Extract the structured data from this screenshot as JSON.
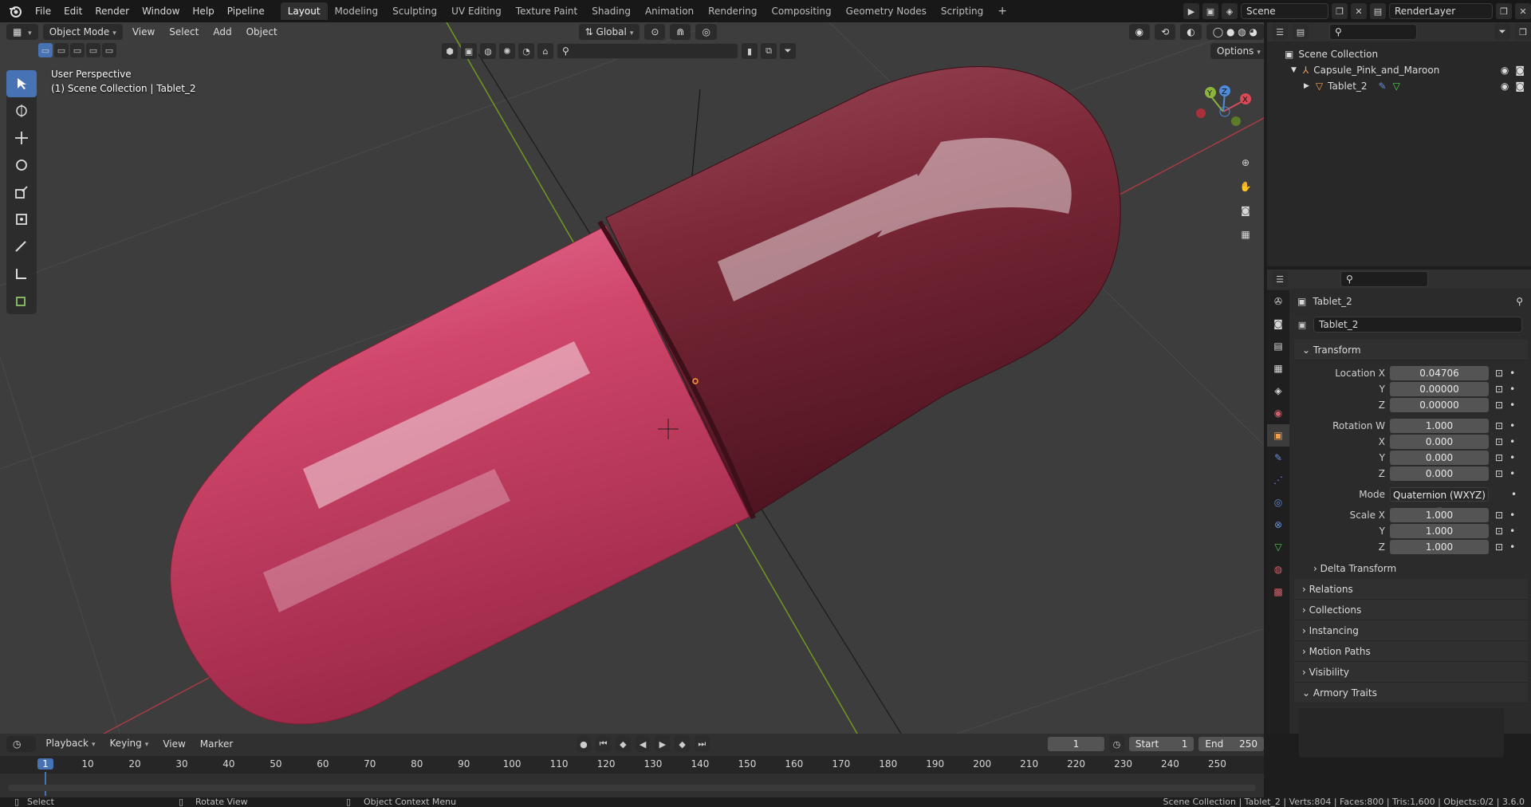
{
  "menus": [
    "File",
    "Edit",
    "Render",
    "Window",
    "Help",
    "Pipeline"
  ],
  "workspaces": [
    "Layout",
    "Modeling",
    "Sculpting",
    "UV Editing",
    "Texture Paint",
    "Shading",
    "Animation",
    "Rendering",
    "Compositing",
    "Geometry Nodes",
    "Scripting"
  ],
  "active_workspace": "Layout",
  "scene_name": "Scene",
  "render_layer": "RenderLayer",
  "viewport": {
    "mode": "Object Mode",
    "menu": [
      "View",
      "Select",
      "Add",
      "Object"
    ],
    "orientation": "Global",
    "options": "Options",
    "overlay_line1": "User Perspective",
    "overlay_line2": "(1) Scene Collection | Tablet_2",
    "gizmo": {
      "x": "X",
      "y": "Y",
      "z": "Z"
    }
  },
  "outliner": {
    "root": "Scene Collection",
    "items": [
      "Capsule_Pink_and_Maroon",
      "Tablet_2"
    ]
  },
  "properties": {
    "object_name": "Tablet_2",
    "data_name": "Tablet_2",
    "transform_label": "Transform",
    "location": {
      "label": "Location X",
      "x": "0.04706",
      "y": "0.00000",
      "z": "0.00000"
    },
    "rotation": {
      "label": "Rotation W",
      "w": "1.000",
      "x": "0.000",
      "y": "0.000",
      "z": "0.000"
    },
    "mode_label": "Mode",
    "mode_value": "Quaternion (WXYZ)",
    "scale": {
      "label": "Scale X",
      "x": "1.000",
      "y": "1.000",
      "z": "1.000"
    },
    "axis_y": "Y",
    "axis_z": "Z",
    "axis_x": "X",
    "sections": [
      "Delta Transform",
      "Relations",
      "Collections",
      "Instancing",
      "Motion Paths",
      "Visibility",
      "Armory Traits"
    ]
  },
  "timeline": {
    "menu": [
      "Playback",
      "Keying",
      "View",
      "Marker"
    ],
    "current_frame": "1",
    "start_label": "Start",
    "start": "1",
    "end_label": "End",
    "end": "250",
    "ticks": [
      "1",
      "10",
      "20",
      "30",
      "40",
      "50",
      "60",
      "70",
      "80",
      "90",
      "100",
      "110",
      "120",
      "130",
      "140",
      "150",
      "160",
      "170",
      "180",
      "190",
      "200",
      "210",
      "220",
      "230",
      "240",
      "250"
    ]
  },
  "status": {
    "left": "Select",
    "mid": "Rotate View",
    "right": "Object Context Menu",
    "info": "Scene Collection | Tablet_2 | Verts:804 | Faces:800 | Tris:1,600 | Objects:0/2 | 3.6.0"
  },
  "colors": {
    "pink": "#d1476c",
    "maroon": "#7c2838",
    "accent": "#4772b3"
  }
}
